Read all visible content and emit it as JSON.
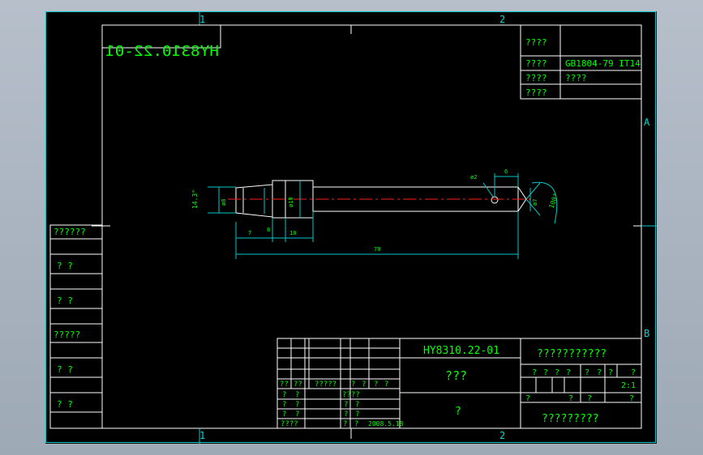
{
  "zones": {
    "top": [
      "1",
      "2"
    ],
    "bottom": [
      "1",
      "2"
    ],
    "right": [
      "A",
      "B"
    ]
  },
  "code_mirrored": "HY8310.22-01",
  "spec_table": [
    {
      "label": "????",
      "value": ""
    },
    {
      "label": "????",
      "value": "GB1804-79 IT14"
    },
    {
      "label": "????",
      "value": "????"
    },
    {
      "label": "????",
      "value": ""
    }
  ],
  "side_labels": [
    "??????",
    "?   ?",
    "?   ?",
    "?????",
    "?   ?",
    "?   ?"
  ],
  "dimensions": {
    "chamfer_angle": "14.3°",
    "d1": "ø8",
    "d2": "ø10",
    "hole": "ø2",
    "len_a": "7",
    "len_b": "8",
    "len_c": "10",
    "len_total": "70",
    "offset": "6",
    "d_tip": "ø7",
    "tip_angle": "100°"
  },
  "title_block": {
    "drawing_no": "HY8310.22-01",
    "part_name": "???",
    "material": "?",
    "company": "???????????",
    "company2": "?????????",
    "stage_cells": [
      "?",
      "?",
      "?",
      "?",
      "?",
      "?",
      "?",
      "?"
    ],
    "scale": "2:1",
    "sheet_cells": [
      "?",
      "?",
      "?",
      "?"
    ],
    "rev_header": [
      "??",
      "??",
      "?????",
      "?",
      "?",
      "?",
      "?"
    ],
    "rows": [
      {
        "a": "?",
        "b": "?",
        "c": "????",
        "d": ""
      },
      {
        "a": "?",
        "b": "?",
        "c": "?",
        "d": "?"
      },
      {
        "a": "?",
        "b": "?",
        "c": "?",
        "d": "?"
      },
      {
        "a": "????",
        "b": "",
        "c": "?",
        "d": "?"
      }
    ],
    "date": "2008.5.18"
  }
}
